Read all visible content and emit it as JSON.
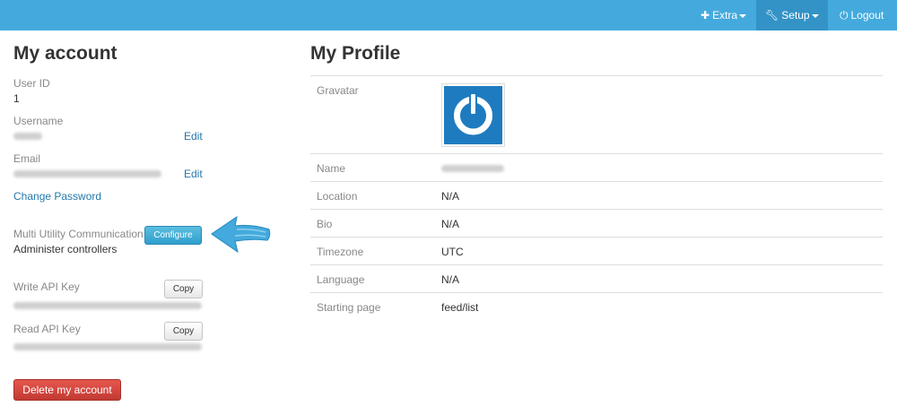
{
  "navbar": {
    "extra_label": "Extra",
    "setup_label": "Setup",
    "logout_label": "Logout",
    "extra_icon": "plus-icon",
    "setup_icon": "wrench-icon",
    "logout_icon": "power-icon"
  },
  "account": {
    "title": "My account",
    "user_id_label": "User ID",
    "user_id_value": "1",
    "username_label": "Username",
    "email_label": "Email",
    "edit_label": "Edit",
    "change_password": "Change Password",
    "muc_label": "Multi Utility Communication",
    "configure_label": "Configure",
    "administer_controllers": "Administer controllers",
    "write_api_label": "Write API Key",
    "read_api_label": "Read API Key",
    "copy_label": "Copy",
    "delete_label": "Delete my account"
  },
  "profile": {
    "title": "My Profile",
    "rows": {
      "gravatar": "Gravatar",
      "name": "Name",
      "location": "Location",
      "location_value": "N/A",
      "bio": "Bio",
      "bio_value": "N/A",
      "timezone": "Timezone",
      "timezone_value": "UTC",
      "language": "Language",
      "language_value": "N/A",
      "starting_page": "Starting page",
      "starting_page_value": "feed/list"
    }
  },
  "colors": {
    "navbar": "#44aadd",
    "navbar_active": "#3393c6",
    "link": "#2277aa",
    "configure_button": "#2f9fcd",
    "delete_button": "#c23a33",
    "gravatar_bg": "#1f7bbf",
    "arrow": "#44aadd"
  }
}
